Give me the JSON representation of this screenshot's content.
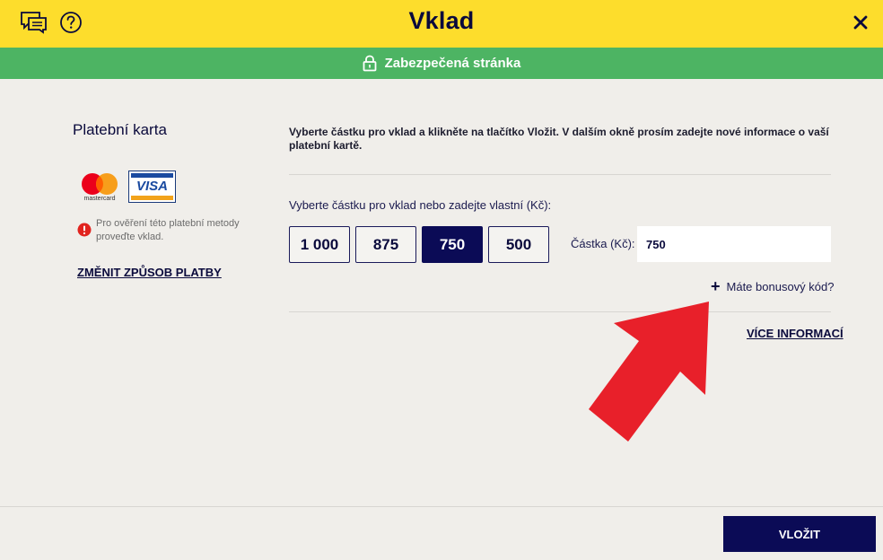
{
  "header": {
    "title": "Vklad",
    "chat_icon": "chat-bubbles-icon",
    "help_icon": "question-circle-icon",
    "close_icon": "close-x-icon"
  },
  "secure_bar": {
    "text": "Zabezpečená stránka",
    "icon": "padlock-icon"
  },
  "payment_method": {
    "title": "Platební karta",
    "logos": [
      "mastercard",
      "VISA"
    ],
    "mastercard_text": "mastercard",
    "visa_text": "VISA",
    "warning_text": "Pro ověření této platební metody proveďte vklad.",
    "change_link": "ZMĚNIT ZPŮSOB PLATBY"
  },
  "main": {
    "instructions": "Vyberte částku pro vklad a klikněte na tlačítko Vložit. V dalším okně prosím zadejte nové informace o vaší platební kartě.",
    "amount_prompt": "Vyberte částku pro vklad nebo zadejte vlastní (Kč):",
    "amount_options": [
      "1 000",
      "875",
      "750",
      "500"
    ],
    "selected_amount": "750",
    "amount_label": "Částka (Kč):",
    "amount_value": "750",
    "bonus_plus": "+",
    "bonus_link": "Máte bonusový kód?",
    "more_info_link": "VÍCE INFORMACÍ"
  },
  "footer": {
    "submit_label": "VLOŽIT"
  },
  "colors": {
    "header_yellow": "#fddd2c",
    "secure_green": "#4db463",
    "navy": "#0b0b56",
    "background": "#f0eeea",
    "annotation_red": "#e8202a"
  }
}
